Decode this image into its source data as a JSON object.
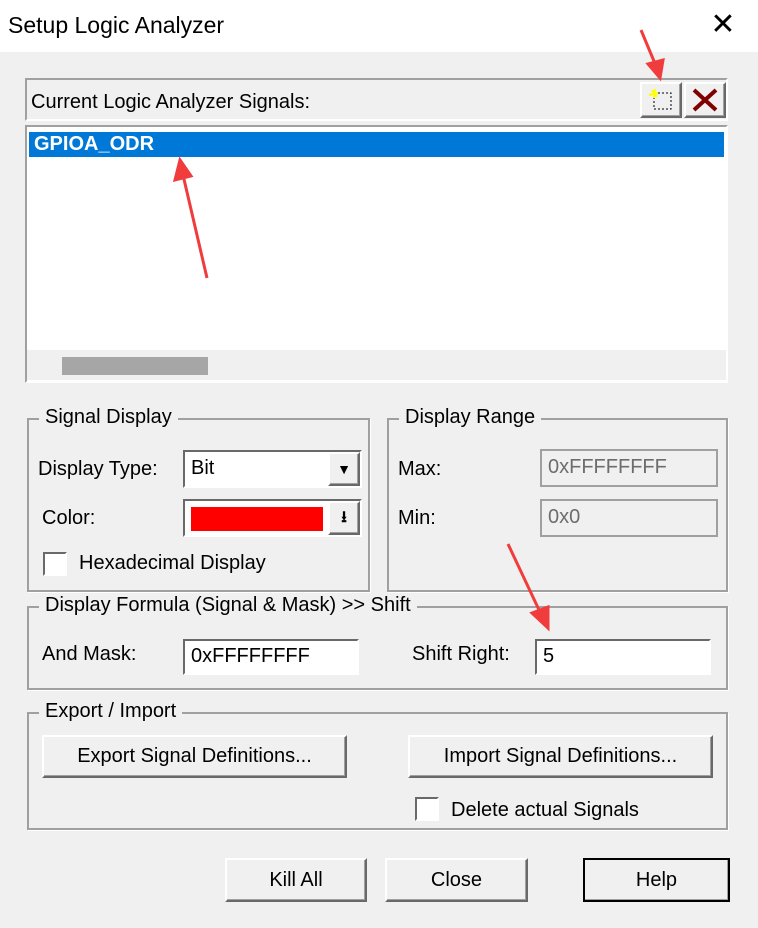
{
  "window": {
    "title": "Setup Logic Analyzer",
    "close_label": "✕"
  },
  "signals": {
    "label": "Current Logic Analyzer Signals:",
    "items": [
      "GPIOA_ODR"
    ],
    "selected": 0,
    "new_icon": "new-signal-icon",
    "delete_icon": "delete-signal-icon"
  },
  "signal_display": {
    "title": "Signal Display",
    "display_type_label": "Display Type:",
    "display_type_value": "Bit",
    "color_label": "Color:",
    "color_value": "#ff0000",
    "hex_label": "Hexadecimal Display",
    "hex_checked": false
  },
  "display_range": {
    "title": "Display Range",
    "max_label": "Max:",
    "max_value": "0xFFFFFFFF",
    "min_label": "Min:",
    "min_value": "0x0"
  },
  "formula": {
    "title": "Display Formula (Signal & Mask) >> Shift",
    "mask_label": "And Mask:",
    "mask_value": "0xFFFFFFFF",
    "shift_label": "Shift Right:",
    "shift_value": "5"
  },
  "export_import": {
    "title": "Export / Import",
    "export_label": "Export Signal Definitions...",
    "import_label": "Import Signal Definitions...",
    "delete_label": "Delete actual Signals",
    "delete_checked": false
  },
  "footer": {
    "kill_all": "Kill All",
    "close": "Close",
    "help": "Help"
  },
  "colors": {
    "selection": "#0078d7",
    "annotation_arrow": "#f03c3c"
  }
}
